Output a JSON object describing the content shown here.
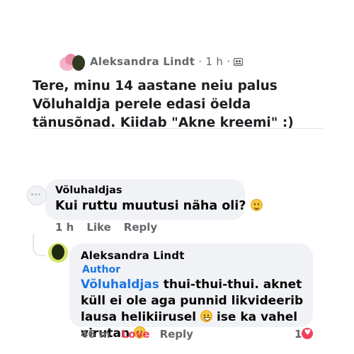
{
  "post": {
    "author": "Aleksandra Lindt",
    "meta": " · 1 h · ",
    "text": "Tere, minu 14 aastane neiu palus Võluhaldja perele edasi öelda tänusõnad.  Kiidab \"Akne kreemi\" :)"
  },
  "comment1": {
    "author": "Võluhaldjas",
    "text": "Kui ruttu muutusi näha oli? ",
    "time": "1 h",
    "like": "Like",
    "reply": "Reply"
  },
  "comment2": {
    "author": "Aleksandra Lindt",
    "badge": "Author",
    "mention": "Võluhaldjas",
    "text_part1": " thui-thui-thui. aknet küll ei ole aga punnid likvideerib lausa helikiirusel ",
    "text_part2": " ise ka vahel virutan ",
    "time": "46 m",
    "love": "Love",
    "reply": "Reply",
    "reaction_count": "1"
  },
  "colors": {
    "link": "#1b74e4",
    "love": "#f33e58",
    "bubble": "#f0f2f5",
    "muted": "#65676b"
  },
  "icons": [
    "group-privacy-icon",
    "smile-emoji-icon",
    "grin-emoji-icon",
    "heart-reaction-icon"
  ]
}
